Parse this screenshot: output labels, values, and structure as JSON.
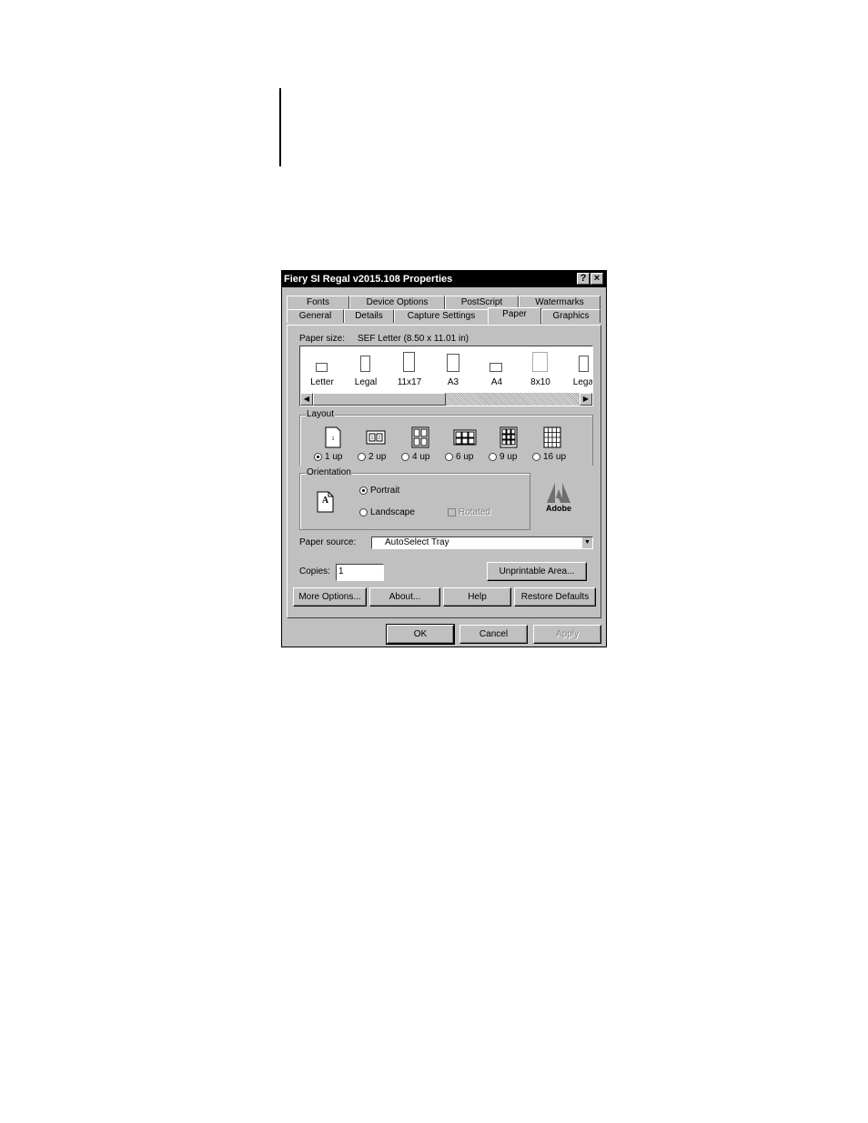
{
  "window": {
    "title": "Fiery SI Regal v2015.108 Properties",
    "help_btn": "?",
    "close_btn": "×"
  },
  "tabs": {
    "row_back": [
      "Fonts",
      "Device Options",
      "PostScript",
      "Watermarks"
    ],
    "row_front": [
      "General",
      "Details",
      "Capture Settings",
      "Paper",
      "Graphics"
    ],
    "active": "Paper"
  },
  "paper": {
    "size_label": "Paper size:",
    "size_value": "SEF Letter (8.50 x 11.01 in)",
    "items": [
      "Letter",
      "Legal",
      "11x17",
      "A3",
      "A4",
      "8x10",
      "Legal"
    ]
  },
  "layout": {
    "group_label": "Layout",
    "options": [
      "1 up",
      "2 up",
      "4 up",
      "6 up",
      "9 up",
      "16 up"
    ],
    "selected": "1 up"
  },
  "orientation": {
    "group_label": "Orientation",
    "preview_letter": "A",
    "portrait": "Portrait",
    "landscape": "Landscape",
    "rotated": "Rotated",
    "selected": "Portrait"
  },
  "adobe_logo_text": "Adobe",
  "paper_source": {
    "label": "Paper source:",
    "value": "AutoSelect Tray"
  },
  "copies": {
    "label": "Copies:",
    "value": "1"
  },
  "buttons": {
    "unprintable": "Unprintable Area...",
    "more_options": "More Options...",
    "about": "About...",
    "help": "Help",
    "restore": "Restore Defaults",
    "ok": "OK",
    "cancel": "Cancel",
    "apply": "Apply"
  }
}
